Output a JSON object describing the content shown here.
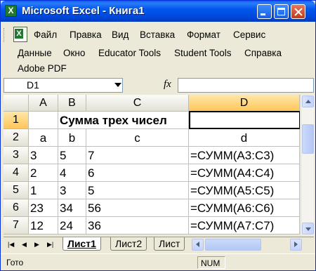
{
  "window": {
    "title": "Microsoft Excel - Книга1",
    "controls": {
      "minimize": "minimize",
      "maximize": "maximize",
      "close": "close"
    }
  },
  "menu": {
    "row1": [
      "Файл",
      "Правка",
      "Вид",
      "Вставка",
      "Формат",
      "Сервис"
    ],
    "row2": [
      "Данные",
      "Окно",
      "Educator Tools",
      "Student Tools",
      "Справка"
    ],
    "row3": [
      "Adobe PDF"
    ]
  },
  "doc_controls": {
    "min": "_",
    "restore": "▭",
    "close": "✕"
  },
  "formula_bar": {
    "name_box": "D1",
    "fx": "fx",
    "content": ""
  },
  "grid": {
    "columns": [
      "A",
      "B",
      "C",
      "D"
    ],
    "rows": [
      "1",
      "2",
      "3",
      "4",
      "5",
      "6",
      "7"
    ],
    "title_row_text": "Сумма трех чисел",
    "header_row": [
      "a",
      "b",
      "c",
      "d"
    ],
    "data": [
      [
        "3",
        "5",
        "7",
        "=СУММ(A3:C3)"
      ],
      [
        "2",
        "4",
        "6",
        "=СУММ(A4:C4)"
      ],
      [
        "1",
        "3",
        "5",
        "=СУММ(A5:C5)"
      ],
      [
        "23",
        "34",
        "56",
        "=СУММ(A6:C6)"
      ],
      [
        "12",
        "24",
        "36",
        "=СУММ(A7:C7)"
      ]
    ],
    "active_cell": "D1"
  },
  "sheet_tabs": [
    "Лист1",
    "Лист2",
    "Лист"
  ],
  "active_sheet": "Лист1",
  "status": {
    "left": "Гото",
    "num": "NUM"
  }
}
